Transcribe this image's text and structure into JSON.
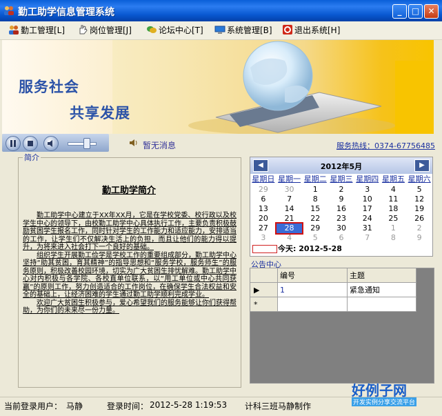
{
  "window": {
    "title": "勤工助学信息管理系统",
    "controls": {
      "minimize": "_",
      "maximize": "□",
      "close": "✕"
    }
  },
  "menu": [
    {
      "label": "勤工管理[L]",
      "icon": "users-icon"
    },
    {
      "label": "岗位管理[J]",
      "icon": "hand-icon"
    },
    {
      "label": "论坛中心[T]",
      "icon": "chat-icon"
    },
    {
      "label": "系统管理[B]",
      "icon": "monitor-icon"
    },
    {
      "label": "退出系统[H]",
      "icon": "exit-icon"
    }
  ],
  "banner": {
    "slogan_line1": "服务社会",
    "slogan_line2": "共享发展"
  },
  "toolbar": {
    "news_text": "暂无消息",
    "hotline": "服务热线：0374-67756485"
  },
  "intro": {
    "legend": "简介",
    "title": "勤工助学简介",
    "paragraphs": [
      "勤工助学中心建立于XX年XX月，它是在学校党委、校行政以及校学生中心的领导下，由校勤工助学中心具体执行工作，主要负责积极鼓励贫困学生报名工作，同时针对学生的工作能力和适应能力，安排适当的工作，让学生们不仅解决生活上的负担，而且让他们的能力得以提升，为将来进入社会打下一个良好的基础。",
      "组织学生开展勤工俭学是学校工作的重要组成部分，勤工助学中心坚持“助其贫困，育其精神”的指导思想和“服务学校，服务师生”的服务原则，积极改善校园环境，切实为广大贫困生排忧解难。勤工助学中心对内积极与各学院、各校直单位联系，以“用工单位或中心共同获赢”的原则工作，努力创造适合的工作岗位，在确保学生合法权益和安全的基础上，让经济困难的学生通过勤工助学顺利完成学业。",
      "欢迎广大贫困生积极参与，爱心希望我们的服务能够让你们获得帮助，为你们的未来尽一份力量。"
    ]
  },
  "calendar": {
    "prev": "◀",
    "next": "▶",
    "month_title": "2012年5月",
    "weekdays": [
      "星期日",
      "星期一",
      "星期二",
      "星期三",
      "星期四",
      "星期五",
      "星期六"
    ],
    "weeks": [
      [
        "29",
        "30",
        "1",
        "2",
        "3",
        "4",
        "5"
      ],
      [
        "6",
        "7",
        "8",
        "9",
        "10",
        "11",
        "12"
      ],
      [
        "13",
        "14",
        "15",
        "16",
        "17",
        "18",
        "19"
      ],
      [
        "20",
        "21",
        "22",
        "23",
        "24",
        "25",
        "26"
      ],
      [
        "27",
        "28",
        "29",
        "30",
        "31",
        "1",
        "2"
      ],
      [
        "3",
        "4",
        "5",
        "6",
        "7",
        "8",
        "9"
      ]
    ],
    "selected": "28",
    "today_label": "今天:  2012-5-28"
  },
  "notice": {
    "legend": "公告中心",
    "columns": [
      "编号",
      "主题"
    ],
    "rows": [
      {
        "id": "1",
        "subject": "紧急通知"
      }
    ],
    "current_row_marker": "▶",
    "new_row_marker": "*"
  },
  "status": {
    "user_label": "当前登录用户：",
    "user": "马静",
    "time_label": "登录时间：",
    "time": "2012-5-28 1:19:53",
    "credit": "计科三班马静制作"
  },
  "watermark": {
    "title": "好例子网",
    "subtitle": "开发实例分享交流平台"
  },
  "colors": {
    "title_bar": "#0a5fd8",
    "link": "#1a30a0",
    "banner_yellow": "#f8c400",
    "selected_day": "#3a6cd6"
  }
}
